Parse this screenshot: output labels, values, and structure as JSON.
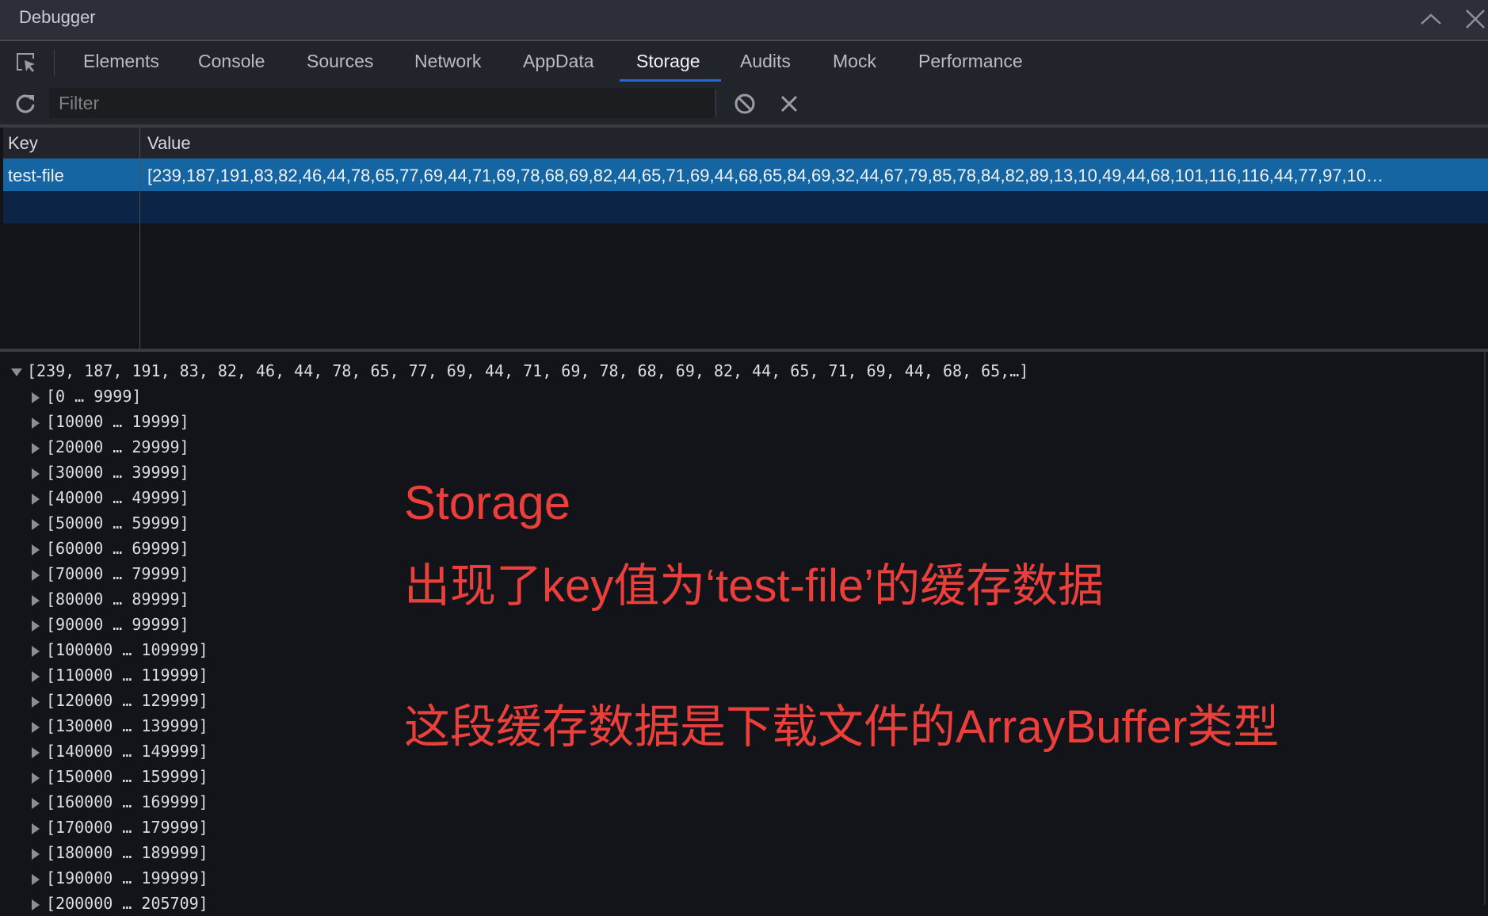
{
  "window": {
    "title": "Debugger",
    "collapse_icon": "chevron-up-icon",
    "close_icon": "close-icon"
  },
  "tabs": [
    {
      "label": "Elements"
    },
    {
      "label": "Console"
    },
    {
      "label": "Sources"
    },
    {
      "label": "Network"
    },
    {
      "label": "AppData"
    },
    {
      "label": "Storage",
      "active": true
    },
    {
      "label": "Audits"
    },
    {
      "label": "Mock"
    },
    {
      "label": "Performance"
    }
  ],
  "filter": {
    "placeholder": "Filter",
    "value": ""
  },
  "table": {
    "headers": {
      "key": "Key",
      "value": "Value"
    },
    "rows": [
      {
        "key": "test-file",
        "value": "[239,187,191,83,82,46,44,78,65,77,69,44,71,69,78,68,69,82,44,65,71,69,44,68,65,84,69,32,44,67,79,85,78,84,82,89,13,10,49,44,68,101,116,116,44,77,97,10…"
      }
    ]
  },
  "preview": {
    "root": "[239, 187, 191, 83, 82, 46, 44, 78, 65, 77, 69, 44, 71, 69, 78, 68, 69, 82, 44, 65, 71, 69, 44, 68, 65,…]",
    "groups": [
      "[0 … 9999]",
      "[10000 … 19999]",
      "[20000 … 29999]",
      "[30000 … 39999]",
      "[40000 … 49999]",
      "[50000 … 59999]",
      "[60000 … 69999]",
      "[70000 … 79999]",
      "[80000 … 89999]",
      "[90000 … 99999]",
      "[100000 … 109999]",
      "[110000 … 119999]",
      "[120000 … 129999]",
      "[130000 … 139999]",
      "[140000 … 149999]",
      "[150000 … 159999]",
      "[160000 … 169999]",
      "[170000 … 179999]",
      "[180000 … 189999]",
      "[190000 … 199999]",
      "[200000 … 205709]"
    ]
  },
  "annotations": {
    "line1": "Storage",
    "line2": "出现了key值为‘test-file’的缓存数据",
    "line3": "这段缓存数据是下载文件的ArrayBuffer类型",
    "color": "#ea3f3a"
  },
  "colors": {
    "accent": "#2368d8",
    "selected_row": "#1565a3"
  }
}
